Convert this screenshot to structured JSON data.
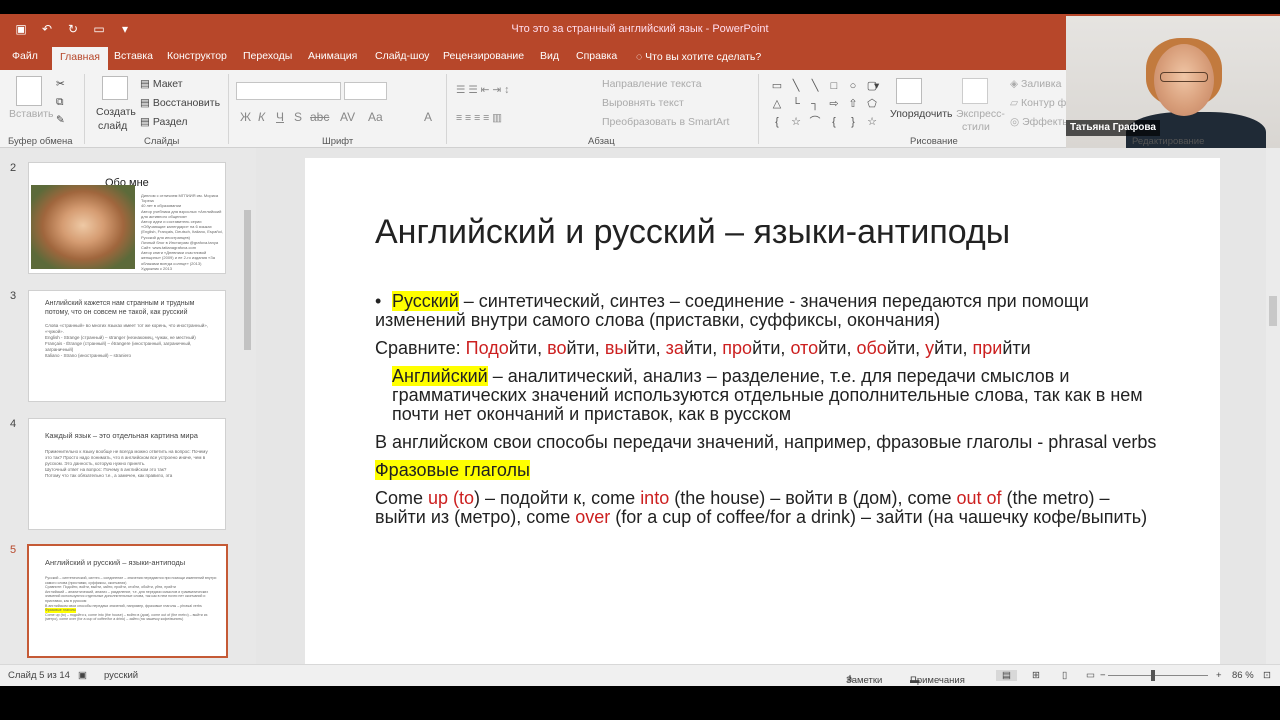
{
  "window": {
    "title": "Что это за странный английский язык  -  PowerPoint"
  },
  "menu": {
    "tabs": [
      "Файл",
      "Главная",
      "Вставка",
      "Конструктор",
      "Переходы",
      "Анимация",
      "Слайд-шоу",
      "Рецензирование",
      "Вид",
      "Справка"
    ],
    "active_tab": "Главная",
    "tell_me": "Что вы хотите сделать?"
  },
  "ribbon": {
    "paste": "Вставить",
    "new_slide_1": "Создать",
    "new_slide_2": "слайд",
    "layout": "Макет",
    "reset": "Восстановить",
    "section": "Раздел",
    "text_direction": "Направление текста",
    "align_text": "Выровнять текст",
    "smartart": "Преобразовать в SmartArt",
    "arrange": "Упорядочить",
    "quick_styles_1": "Экспресс-",
    "quick_styles_2": "стили",
    "fill": "Заливка",
    "outline": "Контур ф",
    "effects": "Эффекты",
    "groups": {
      "clipboard": "Буфер обмена",
      "slides": "Слайды",
      "font": "Шрифт",
      "paragraph": "Абзац",
      "drawing": "Рисование",
      "editing": "Редактирование"
    },
    "format_buttons": [
      "Ж",
      "К",
      "Ч",
      "S",
      "abc",
      "AV",
      "Aa",
      "A"
    ]
  },
  "thumbnails": [
    {
      "num": "2",
      "title": "Обо мне",
      "lines": [
        "Диплом с отличием МГПИИЯ им. Мориса Тореза",
        "40 лет в образовании",
        "Автор учебника для взрослых «Английский для активного общения»",
        "Автор идеи и составитель серии «Обучающие календари» на 6 языках (English, Français, Deutsch, Italiano, Español, Русский для иностранцев)",
        "Личный блог в Инстаграм @grafova.tanya",
        "Сайт: www.tatianagrafova.com",
        "Автор книги «Дневники счастливой женщины» (2009) и ее 2-го издания «За облаками всегда солнце» (2013)",
        "Художник с 2013"
      ]
    },
    {
      "num": "3",
      "title": "Английский кажется нам странным и трудным потому, что он совсем не такой, как русский",
      "lines": [
        "Слова «странный» во многих языках имеет тот же корень, что иностранный», «чужой».",
        "English - Strange (странный) – stranger (незнакомец, чужак, не местный)",
        "Français - Étrange (странный) – étrangere (иностранный, заграничный, заграничный)",
        "Italiano - Strano (иностранный) – straniero"
      ]
    },
    {
      "num": "4",
      "title": "Каждый язык – это отдельная картина мира",
      "lines": [
        "Применительно к языку вообще не всегда можно ответить на вопрос: Почему это так? Просто надо понимать, что в английском все устроено иначе, чем в русском. Это данность, которую нужно принять.",
        "Шуточный ответ на вопрос: Почему в английском это так?",
        "Потому что так обязательно т.е., а замечен, как правило, эта"
      ]
    },
    {
      "num": "5",
      "title": "Английский и русский – языки-антиподы",
      "lines": [
        "Русский – синтетический, синтез – соединение – значения передаются при помощи изменений внутри самого слова (приставки, суффиксы, окончания)",
        "Сравните: Подойти, войти, выйти, зайти, пройти, отойти, обойти, уйти, прийти",
        "Английский – аналитический, анализ – разделение, т.е. для передачи смыслов и грамматических значений используются отдельные дополнительные слова, так как в нем почти нет окончаний и приставок, как в русском",
        "В английском свои способы передачи значений, например, фразовые глаголы – phrasal verbs",
        "Фразовые глаголы",
        "Come up (to) – подойти к, come into (the house) – войти в (дом), come out of (the metro) – выйти из (метро), come over (for a cup of coffee/for a drink) – зайти (на чашечку кофе/выпить)"
      ]
    }
  ],
  "slide": {
    "title": "Английский и русский – языки-антиподы",
    "russian_label": "Русский",
    "russian_text": " – синтетический, синтез – соединение - значения передаются при помощи изменений внутри самого слова (приставки, суффиксы, окончания)",
    "compare_label": "Сравните: ",
    "compare_words": [
      {
        "prefix": "Подо",
        "root": "йти"
      },
      {
        "prefix": "во",
        "root": "йти"
      },
      {
        "prefix": "вы",
        "root": "йти"
      },
      {
        "prefix": "за",
        "root": "йти"
      },
      {
        "prefix": "про",
        "root": "йти"
      },
      {
        "prefix": "ото",
        "root": "йти"
      },
      {
        "prefix": "обо",
        "root": "йти"
      },
      {
        "prefix": "у",
        "root": "йти"
      },
      {
        "prefix": "при",
        "root": "йти"
      }
    ],
    "english_label": "Английский",
    "english_text": " – аналитический, анализ – разделение, т.е. для передачи смыслов и грамматических значений используются отдельные дополнительные слова, так как в нем почти нет окончаний и приставок, как в русском",
    "phrasal_text": "В английском свои способы передачи значений, например, фразовые глаголы - phrasal verbs",
    "phrasal_label": "Фразовые глаголы",
    "examples": [
      {
        "t": "Come ",
        "red": false
      },
      {
        "t": "up (to",
        "red": true
      },
      {
        "t": ") – подойти к, come ",
        "red": false
      },
      {
        "t": "into",
        "red": true
      },
      {
        "t": " (the house) – войти в (дом), come ",
        "red": false
      },
      {
        "t": "out of",
        "red": true
      },
      {
        "t": " (the metro) – выйти из (метро), come ",
        "red": false
      },
      {
        "t": "over",
        "red": true
      },
      {
        "t": " (for a cup of coffee/for a drink) – зайти (на чашечку кофе/выпить)",
        "red": false
      }
    ]
  },
  "status": {
    "slide_counter": "Слайд 5 из 14",
    "language": "русский",
    "notes": "Заметки",
    "comments": "Примечания",
    "zoom": "86 %",
    "zoom_level": 86
  },
  "webcam": {
    "name": "Татьяна Графова"
  },
  "colors": {
    "accent": "#b7472a",
    "highlight": "#ffff00",
    "prefix_red": "#cc1f1f"
  }
}
